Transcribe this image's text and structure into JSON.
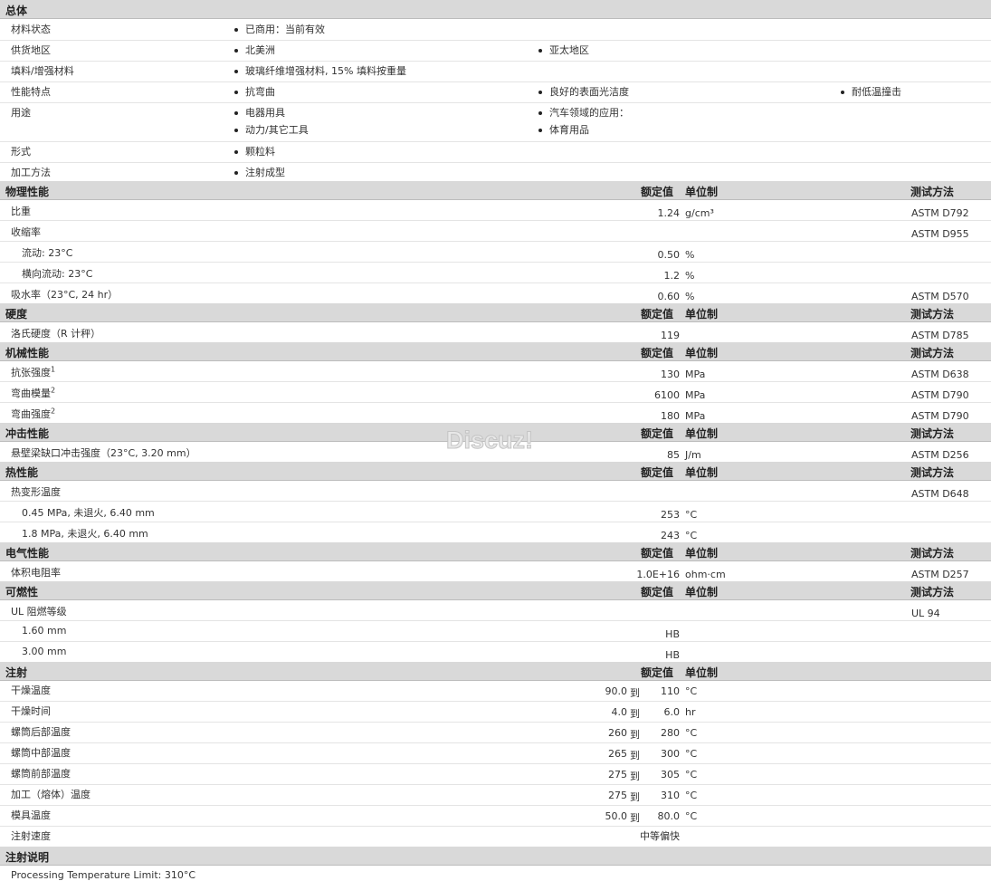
{
  "general": {
    "title": "总体",
    "rows": [
      {
        "label": "材料状态",
        "items": [
          "已商用：当前有效"
        ]
      },
      {
        "label": "供货地区",
        "items": [
          "北美洲",
          "亚太地区"
        ]
      },
      {
        "label": "填料/增强材料",
        "items": [
          "玻璃纤维增强材料, 15% 填料按重量"
        ]
      },
      {
        "label": "性能特点",
        "items": [
          "抗弯曲",
          "良好的表面光洁度",
          "耐低温撞击"
        ]
      },
      {
        "label": "用途",
        "items": [
          "电器用具",
          "汽车领域的应用：",
          "动力/其它工具",
          "体育用品"
        ]
      },
      {
        "label": "形式",
        "items": [
          "颗粒料"
        ]
      },
      {
        "label": "加工方法",
        "items": [
          "注射成型"
        ]
      }
    ]
  },
  "headers": {
    "nominal": "额定值",
    "unit": "单位制",
    "test": "测试方法"
  },
  "physical": {
    "title": "物理性能",
    "rows": [
      {
        "label": "比重",
        "value": "1.24",
        "unit": "g/cm³",
        "test": "ASTM D792"
      },
      {
        "label": "收缩率",
        "value": "",
        "unit": "",
        "test": "ASTM D955"
      },
      {
        "label": "流动: 23°C",
        "value": "0.50",
        "unit": "%",
        "test": ""
      },
      {
        "label": "横向流动: 23°C",
        "value": "1.2",
        "unit": "%",
        "test": ""
      },
      {
        "label": "吸水率（23°C, 24 hr）",
        "value": "0.60",
        "unit": "%",
        "test": "ASTM D570"
      }
    ]
  },
  "hardness": {
    "title": "硬度",
    "rows": [
      {
        "label": "洛氏硬度（R 计秤）",
        "value": "119",
        "unit": "",
        "test": "ASTM D785"
      }
    ]
  },
  "mechanical": {
    "title": "机械性能",
    "rows": [
      {
        "label": "抗张强度",
        "sup": "1",
        "value": "130",
        "unit": "MPa",
        "test": "ASTM D638"
      },
      {
        "label": "弯曲模量",
        "sup": "2",
        "value": "6100",
        "unit": "MPa",
        "test": "ASTM D790"
      },
      {
        "label": "弯曲强度",
        "sup": "2",
        "value": "180",
        "unit": "MPa",
        "test": "ASTM D790"
      }
    ]
  },
  "impact": {
    "title": "冲击性能",
    "rows": [
      {
        "label": "悬壁梁缺口冲击强度（23°C, 3.20 mm）",
        "value": "85",
        "unit": "J/m",
        "test": "ASTM D256"
      }
    ]
  },
  "thermal": {
    "title": "热性能",
    "rows": [
      {
        "label": "热变形温度",
        "value": "",
        "unit": "",
        "test": "ASTM D648"
      },
      {
        "label": "0.45 MPa, 未退火, 6.40 mm",
        "value": "253",
        "unit": "°C",
        "test": ""
      },
      {
        "label": "1.8 MPa, 未退火, 6.40 mm",
        "value": "243",
        "unit": "°C",
        "test": ""
      }
    ]
  },
  "electrical": {
    "title": "电气性能",
    "rows": [
      {
        "label": "体积电阻率",
        "value": "1.0E+16",
        "unit": "ohm·cm",
        "test": "ASTM D257"
      }
    ]
  },
  "flammability": {
    "title": "可燃性",
    "rows": [
      {
        "label": "UL 阻燃等级",
        "value": "",
        "unit": "",
        "test": "UL 94"
      },
      {
        "label": "1.60 mm",
        "value": "HB",
        "unit": "",
        "test": ""
      },
      {
        "label": "3.00 mm",
        "value": "HB",
        "unit": "",
        "test": ""
      }
    ]
  },
  "injection": {
    "title": "注射",
    "to": "到",
    "rows": [
      {
        "label": "干燥温度",
        "from": "90.0",
        "to_val": "110",
        "unit": "°C"
      },
      {
        "label": "干燥时间",
        "from": "4.0",
        "to_val": "6.0",
        "unit": "hr"
      },
      {
        "label": "螺筒后部温度",
        "from": "260",
        "to_val": "280",
        "unit": "°C"
      },
      {
        "label": "螺筒中部温度",
        "from": "265",
        "to_val": "300",
        "unit": "°C"
      },
      {
        "label": "螺筒前部温度",
        "from": "275",
        "to_val": "305",
        "unit": "°C"
      },
      {
        "label": "加工（熔体）温度",
        "from": "275",
        "to_val": "310",
        "unit": "°C"
      },
      {
        "label": "模具温度",
        "from": "50.0",
        "to_val": "80.0",
        "unit": "°C"
      },
      {
        "label": "注射速度",
        "from": "",
        "to_val": "",
        "unit": "",
        "single": "中等偏快"
      }
    ]
  },
  "injection_notes": {
    "title": "注射说明",
    "text": "Processing Temperature Limit: 310°C"
  },
  "watermark": "Discuz!"
}
